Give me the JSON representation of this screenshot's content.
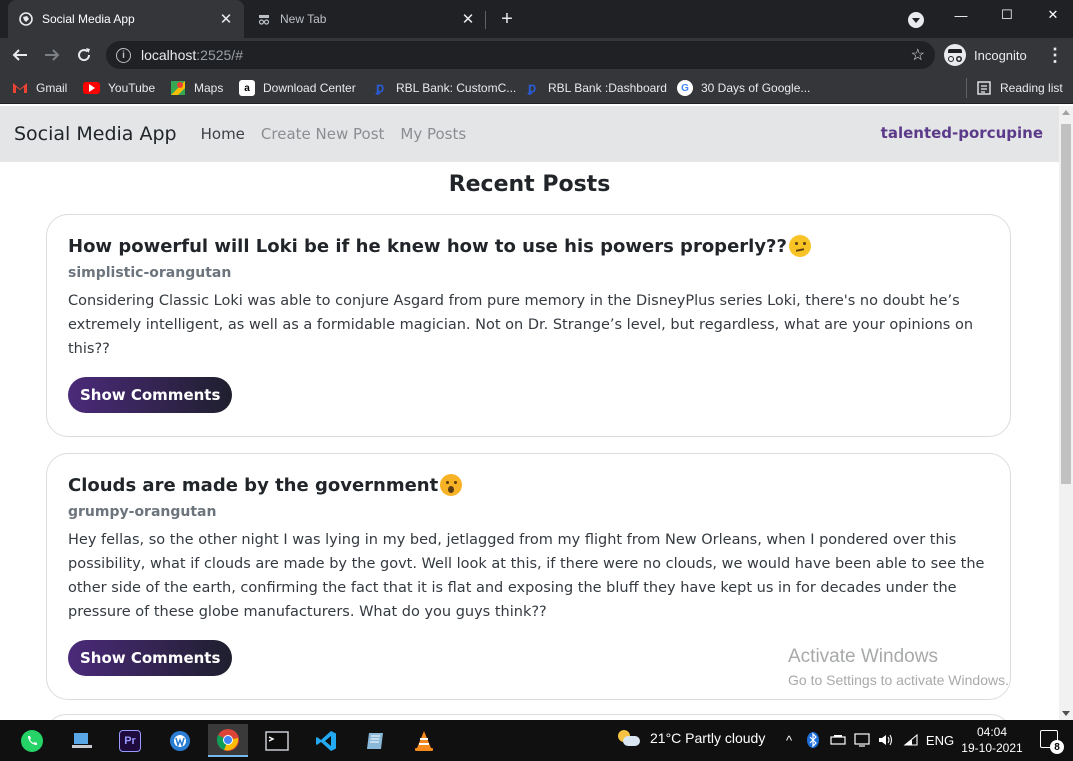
{
  "browser": {
    "tabs": [
      {
        "title": "Social Media App",
        "active": true
      },
      {
        "title": "New Tab",
        "active": false
      }
    ],
    "close_glyph": "✕",
    "new_tab_glyph": "+",
    "window_controls": {
      "minimize": "—",
      "maximize": "☐",
      "close": "✕"
    },
    "address": {
      "host": "localhost",
      "path": ":2525/#"
    },
    "profile_label": "Incognito",
    "bookmarks": [
      {
        "label": "Gmail",
        "icon": "gmail-icon"
      },
      {
        "label": "YouTube",
        "icon": "youtube-icon"
      },
      {
        "label": "Maps",
        "icon": "maps-icon"
      },
      {
        "label": "Download Center",
        "icon": "amazon-icon"
      },
      {
        "label": "RBL Bank: CustomC...",
        "icon": "rbl-icon"
      },
      {
        "label": "RBL Bank :Dashboard",
        "icon": "rbl-icon"
      },
      {
        "label": "30 Days of Google...",
        "icon": "google-icon"
      }
    ],
    "reading_list": "Reading list"
  },
  "app": {
    "brand": "Social Media App",
    "nav": [
      "Home",
      "Create New Post",
      "My Posts"
    ],
    "username": "talented-porcupine",
    "heading": "Recent Posts",
    "posts": [
      {
        "title": "How powerful will Loki be if he knew how to use his powers properly??",
        "emoji": "thinking-face-icon",
        "author": "simplistic-orangutan",
        "body": "Considering Classic Loki was able to conjure Asgard from pure memory in the DisneyPlus series Loki, there's no doubt he’s extremely intelligent, as well as a formidable magician. Not on Dr. Strange’s level, but regardless, what are your opinions on this??",
        "button": "Show Comments"
      },
      {
        "title": "Clouds are made by the government",
        "emoji": "fearful-face-icon",
        "author": "grumpy-orangutan",
        "body": "Hey fellas, so the other night I was lying in my bed, jetlagged from my flight from New Orleans, when I pondered over this possibility, what if clouds are made by the govt. Well look at this, if there were no clouds, we would have been able to see the other side of the earth, confirming the fact that it is flat and exposing the bluff they have kept us in for decades under the pressure of these globe manufacturers. What do you guys think??",
        "button": "Show Comments"
      }
    ],
    "watermark": {
      "line1": "Activate Windows",
      "line2": "Go to Settings to activate Windows."
    }
  },
  "taskbar": {
    "weather": "21°C  Partly cloudy",
    "lang": "ENG",
    "time": "04:04",
    "date": "19-10-2021",
    "notifications": "8"
  }
}
